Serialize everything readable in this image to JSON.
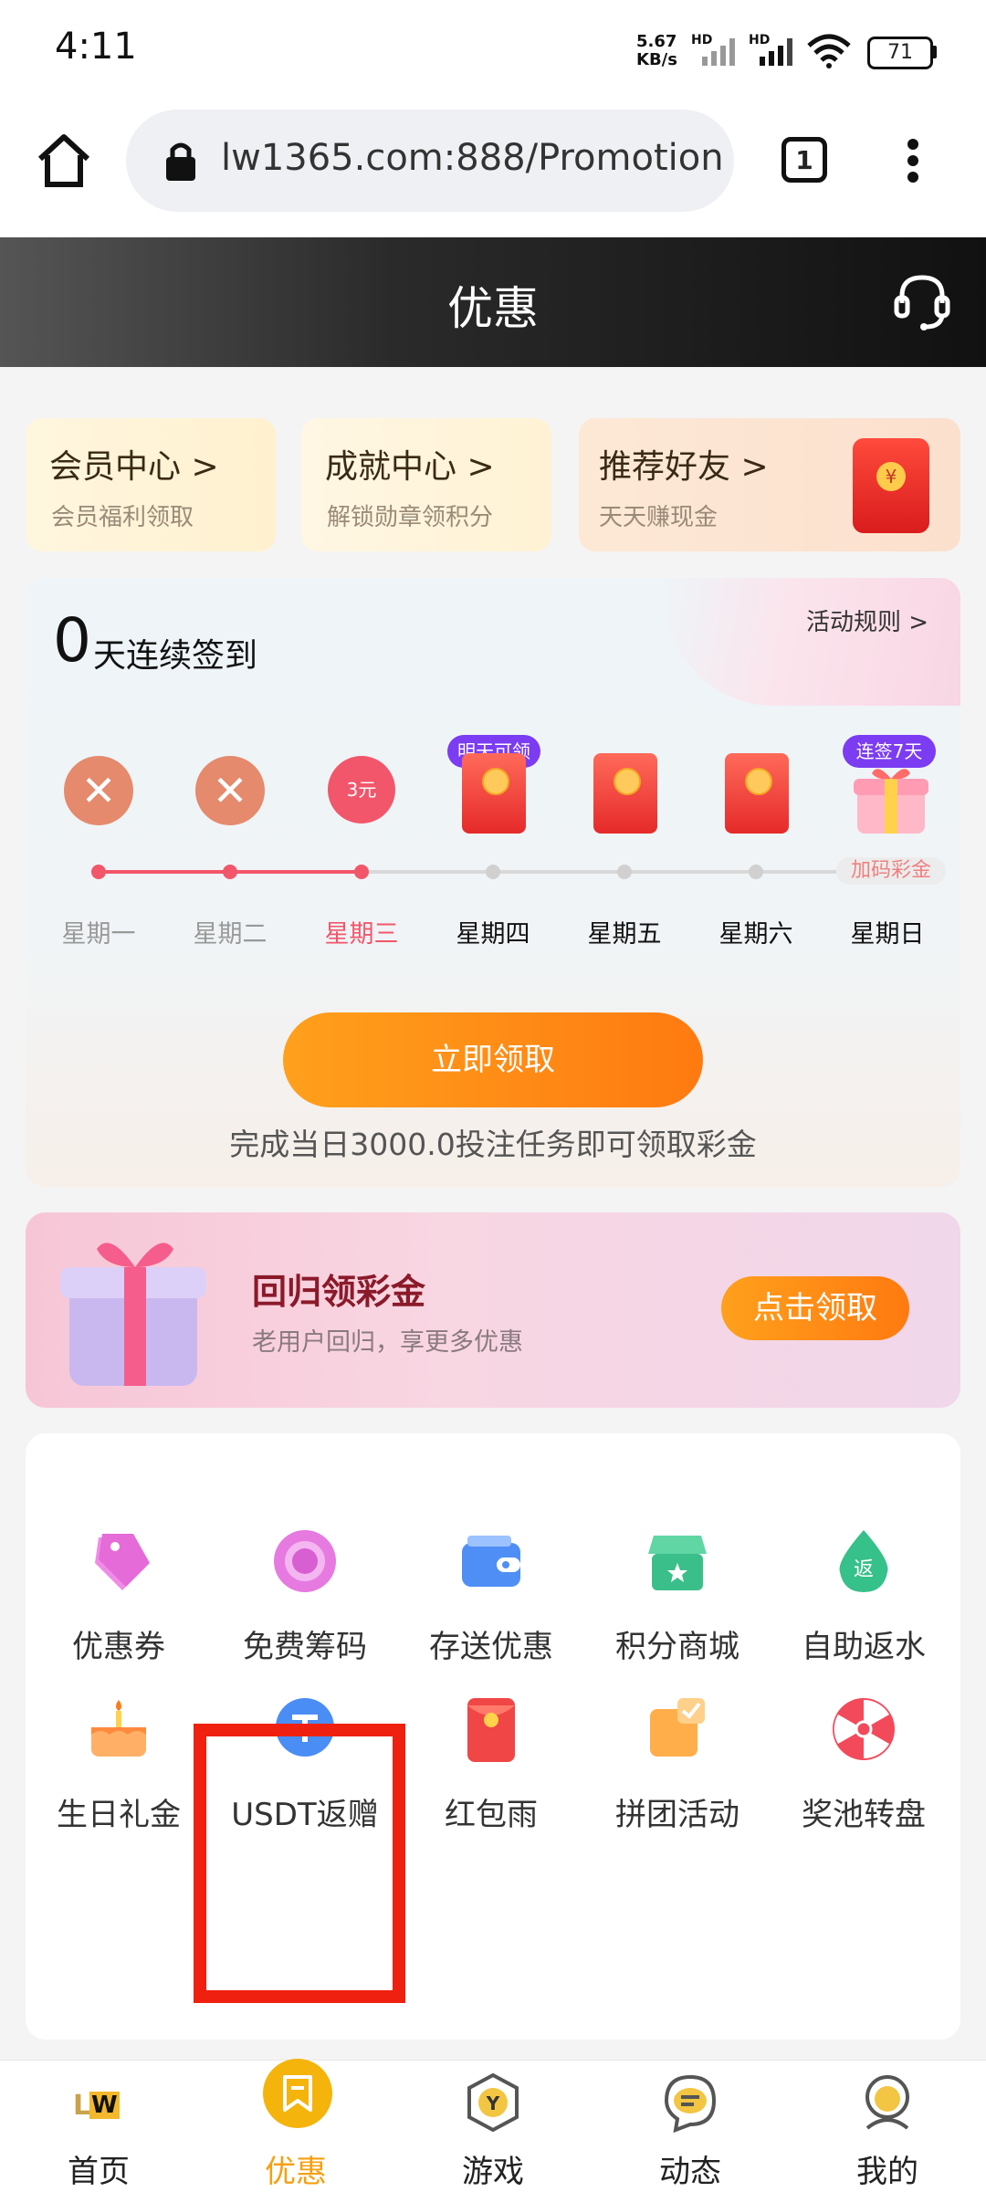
{
  "status_bar": {
    "time": "4:11",
    "net_speed_value": "5.67",
    "net_speed_unit": "KB/s",
    "hd1": "HD",
    "hd2": "HD",
    "battery": "71"
  },
  "browser": {
    "url": "lw1365.com:888/Promotion",
    "tab_count": "1"
  },
  "header": {
    "title": "优惠"
  },
  "quick_cards": [
    {
      "title": "会员中心 >",
      "subtitle": "会员福利领取"
    },
    {
      "title": "成就中心 >",
      "subtitle": "解锁勋章领积分"
    },
    {
      "title": "推荐好友 >",
      "subtitle": "天天赚现金"
    }
  ],
  "checkin": {
    "count": "0",
    "count_text": "天连续签到",
    "rules_link": "活动规则 >",
    "day3_amount": "3元",
    "badge_tomorrow": "明天可领",
    "badge_7days": "连签7天",
    "bonus_tag": "加码彩金",
    "days": [
      "星期一",
      "星期二",
      "星期三",
      "星期四",
      "星期五",
      "星期六",
      "星期日"
    ],
    "claim_button": "立即领取",
    "note": "完成当日3000.0投注任务即可领取彩金"
  },
  "return_banner": {
    "title": "回归领彩金",
    "subtitle": "老用户回归，享更多优惠",
    "button": "点击领取"
  },
  "features": [
    {
      "label": "优惠券",
      "icon": "coupon-icon"
    },
    {
      "label": "免费筹码",
      "icon": "chip-icon"
    },
    {
      "label": "存送优惠",
      "icon": "wallet-icon"
    },
    {
      "label": "积分商城",
      "icon": "store-icon"
    },
    {
      "label": "自助返水",
      "icon": "rebate-drop-icon"
    },
    {
      "label": "生日礼金",
      "icon": "cake-icon"
    },
    {
      "label": "USDT返赠",
      "icon": "usdt-icon"
    },
    {
      "label": "红包雨",
      "icon": "red-envelope-icon"
    },
    {
      "label": "拼团活动",
      "icon": "group-buy-icon"
    },
    {
      "label": "奖池转盘",
      "icon": "prize-wheel-icon"
    }
  ],
  "bottom_nav": [
    {
      "label": "首页",
      "icon": "lw-logo-icon"
    },
    {
      "label": "优惠",
      "icon": "promo-icon",
      "active": true
    },
    {
      "label": "游戏",
      "icon": "games-icon"
    },
    {
      "label": "动态",
      "icon": "chat-icon"
    },
    {
      "label": "我的",
      "icon": "profile-icon"
    }
  ],
  "colors": {
    "accent": "#f5a010",
    "active_day": "#f2566b",
    "badge": "#7b3cf2",
    "highlight_frame": "#f02010"
  }
}
